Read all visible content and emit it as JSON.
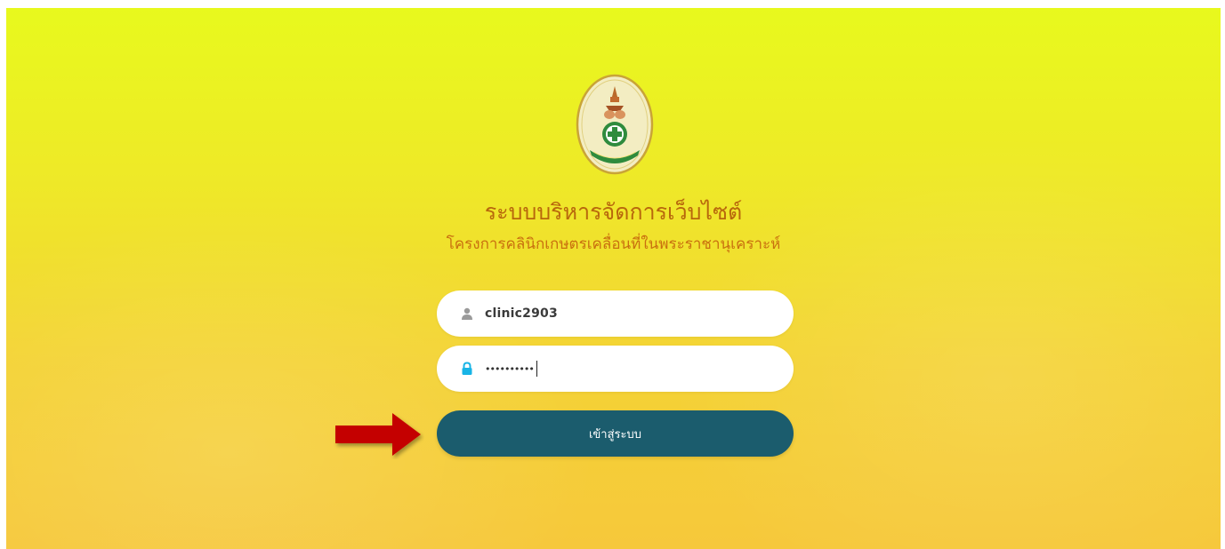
{
  "header": {
    "title": "ระบบบริหารจัดการเว็บไซต์",
    "subtitle": "โครงการคลินิกเกษตรเคลื่อนที่ในพระราชานุเคราะห์"
  },
  "login": {
    "username_value": "clinic2903",
    "username_icon": "user-icon",
    "password_mask": "••••••••••",
    "password_icon": "lock-icon",
    "submit_label": "เข้าสู่ระบบ"
  },
  "annotation": {
    "arrow_icon": "red-arrow-right-icon"
  },
  "colors": {
    "background_top": "#e8f91d",
    "background_bottom": "#f6c83b",
    "title": "#b8670c",
    "button": "#1b5c6d",
    "arrow": "#c40000",
    "lock": "#18b4e6"
  }
}
